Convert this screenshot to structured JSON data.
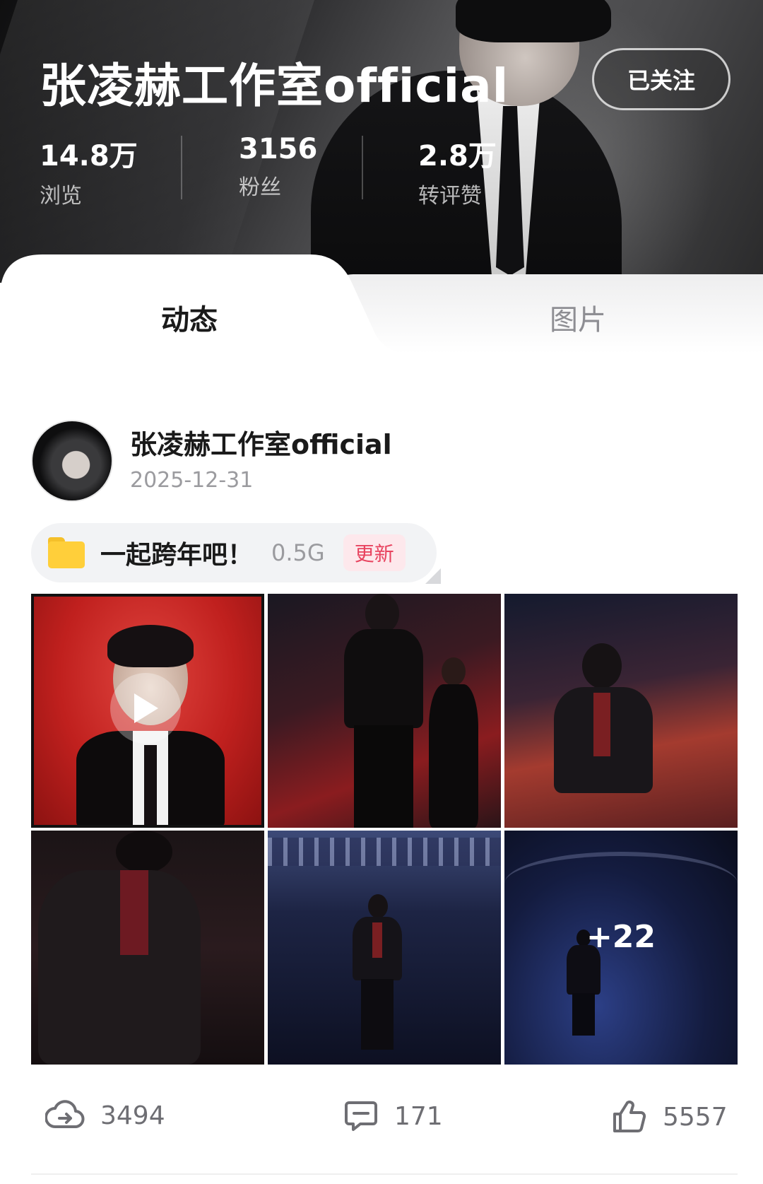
{
  "profile": {
    "name": "张凌赫工作室official",
    "follow_label": "已关注",
    "stats": [
      {
        "value": "14.8万",
        "label": "浏览"
      },
      {
        "value": "3156",
        "label": "粉丝"
      },
      {
        "value": "2.8万",
        "label": "转评赞"
      }
    ]
  },
  "tabs": [
    {
      "label": "动态",
      "active": true
    },
    {
      "label": "图片",
      "active": false
    }
  ],
  "post": {
    "author": "张凌赫工作室official",
    "date": "2025-12-31",
    "folder": {
      "title": "一起跨年吧！",
      "size": "0.5G",
      "badge": "更新"
    },
    "photos": {
      "more_count": "+22"
    },
    "actions": {
      "share_count": "3494",
      "comment_count": "171",
      "like_count": "5557"
    }
  },
  "colors": {
    "badge_text": "#e8435f",
    "badge_bg": "#fde8ec",
    "folder": "#ffcf3a"
  }
}
